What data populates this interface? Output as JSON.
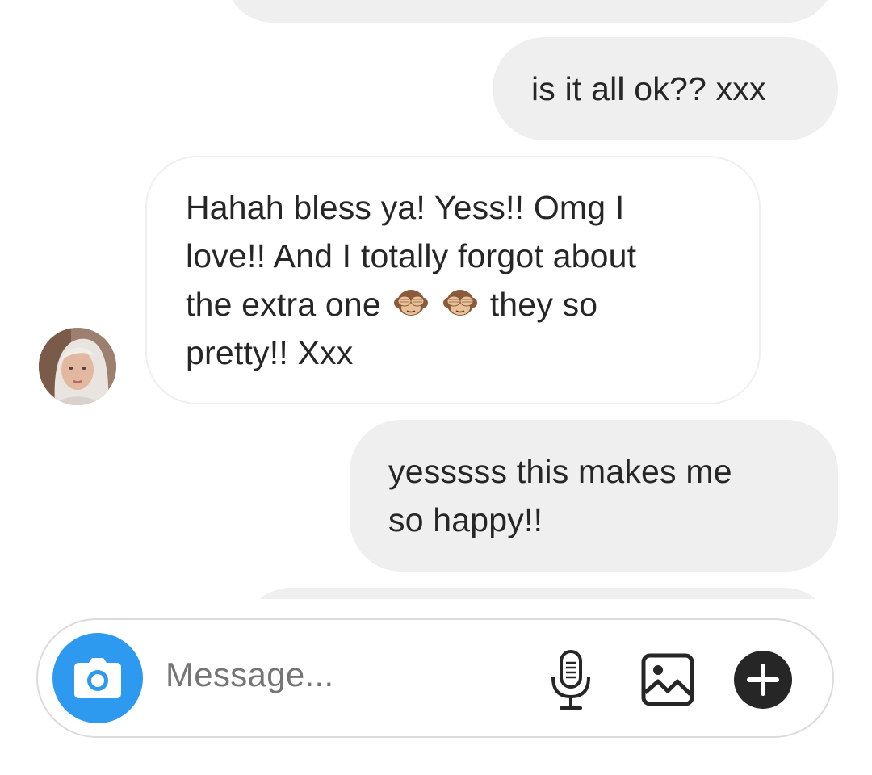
{
  "messages": [
    {
      "from": "me",
      "text": "is it all ok?? xxx"
    },
    {
      "from": "them",
      "line1": "Hahah bless ya! Yess!! Omg I",
      "line2": "love!! And I totally forgot about",
      "line3_before": "the extra one",
      "line3_emoji": [
        "see-no-evil-monkey-icon",
        "see-no-evil-monkey-icon"
      ],
      "line3_after": "they so",
      "line4": "pretty!! Xxx"
    },
    {
      "from": "me",
      "line1": "yesssss this makes me",
      "line2": "so happy!!"
    }
  ],
  "composer": {
    "placeholder": "Message...",
    "icons": [
      "camera-icon",
      "microphone-icon",
      "gallery-icon",
      "plus-icon"
    ]
  },
  "colors": {
    "sent_bubble": "#efefef",
    "received_border": "#efefef",
    "camera_button": "#2d9af0",
    "text": "#262626",
    "placeholder": "#b4b4b4"
  }
}
